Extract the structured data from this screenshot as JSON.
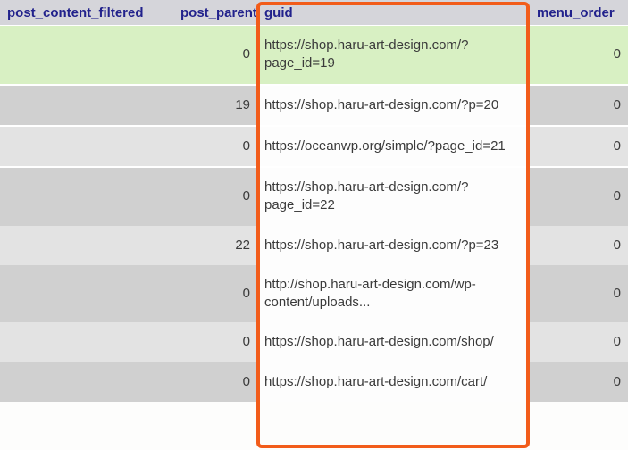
{
  "headers": {
    "post_content_filtered": "post_content_filtered",
    "post_parent": "post_parent",
    "guid": "guid",
    "menu_order": "menu_order"
  },
  "rows": [
    {
      "post_content_filtered": "",
      "post_parent": "0",
      "guid": "https://shop.haru-art-design.com/?page_id=19",
      "menu_order": "0",
      "highlight": true
    },
    {
      "post_content_filtered": "",
      "post_parent": "19",
      "guid": "https://shop.haru-art-design.com/?p=20",
      "menu_order": "0",
      "highlight": false
    },
    {
      "post_content_filtered": "",
      "post_parent": "0",
      "guid": "https://oceanwp.org/simple/?page_id=21",
      "menu_order": "0",
      "highlight": false
    },
    {
      "post_content_filtered": "",
      "post_parent": "0",
      "guid": "https://shop.haru-art-design.com/?page_id=22",
      "menu_order": "0",
      "highlight": false
    },
    {
      "post_content_filtered": "",
      "post_parent": "22",
      "guid": "https://shop.haru-art-design.com/?p=23",
      "menu_order": "0",
      "highlight": false
    },
    {
      "post_content_filtered": "",
      "post_parent": "0",
      "guid": "http://shop.haru-art-design.com/wp-content/uploads...",
      "menu_order": "0",
      "highlight": false
    },
    {
      "post_content_filtered": "",
      "post_parent": "0",
      "guid": "https://shop.haru-art-design.com/shop/",
      "menu_order": "0",
      "highlight": false
    },
    {
      "post_content_filtered": "",
      "post_parent": "0",
      "guid": "https://shop.haru-art-design.com/cart/",
      "menu_order": "0",
      "highlight": false
    }
  ],
  "annotation": {
    "highlighted_column": "guid"
  }
}
